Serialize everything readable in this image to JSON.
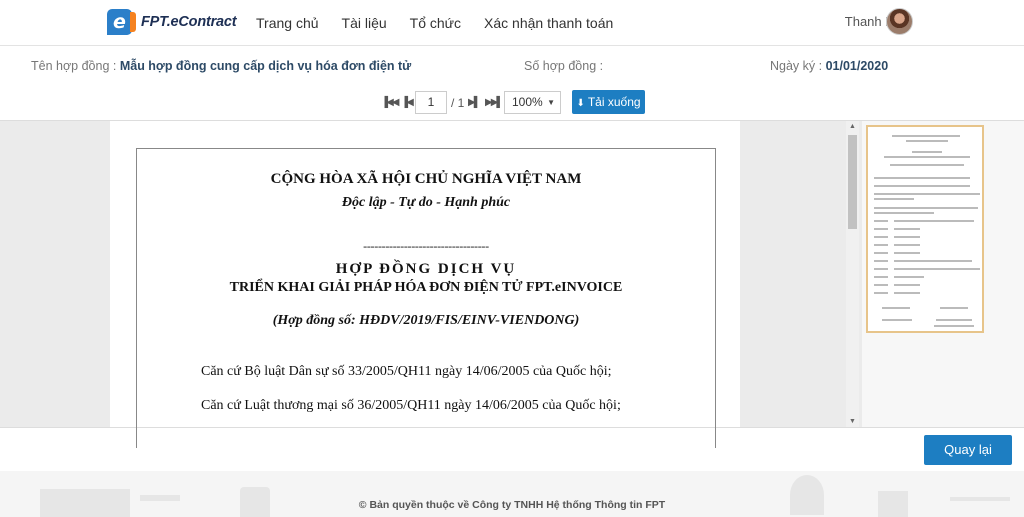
{
  "header": {
    "brand": "FPT.eContract",
    "nav": [
      "Trang chủ",
      "Tài liệu",
      "Tổ chức",
      "Xác nhận thanh toán"
    ],
    "user_name": "Thanh Bình"
  },
  "contract": {
    "name_label": "Tên hợp đồng :",
    "name_value": "Mẫu hợp đồng cung cấp dịch vụ hóa đơn điện tử",
    "number_label": "Số hợp đồng :",
    "number_value": "",
    "date_label": "Ngày ký :",
    "date_value": "01/01/2020"
  },
  "toolbar": {
    "current_page": "1",
    "total_pages": "/ 1",
    "zoom": "100%",
    "download_label": "Tải xuống"
  },
  "document": {
    "line1": "CỘNG HÒA XÃ HỘI CHỦ NGHĨA VIỆT NAM",
    "line2": "Độc lập - Tự do - Hạnh phúc",
    "divider": "----------------------------------",
    "title1": "HỢP ĐỒNG DỊCH VỤ",
    "title2": "TRIỂN KHAI GIẢI PHÁP HÓA ĐƠN ĐIỆN TỬ FPT.eINVOICE",
    "contract_no": "(Hợp đồng số: HĐDV/2019/FIS/EINV-VIENDONG)",
    "para1": "Căn cứ Bộ luật Dân sự số 33/2005/QH11 ngày 14/06/2005 của Quốc hội;",
    "para2": "Căn cứ Luật thương mại số 36/2005/QH11 ngày 14/06/2005 của Quốc hội;"
  },
  "actions": {
    "back_label": "Quay lại"
  },
  "footer": {
    "copyright": "© Bản quyền thuộc về Công ty TNHH Hệ thống Thông tin FPT"
  },
  "colors": {
    "accent": "#1d7ec2",
    "brand_orange": "#f58220",
    "brand_navy": "#1d2f54"
  }
}
